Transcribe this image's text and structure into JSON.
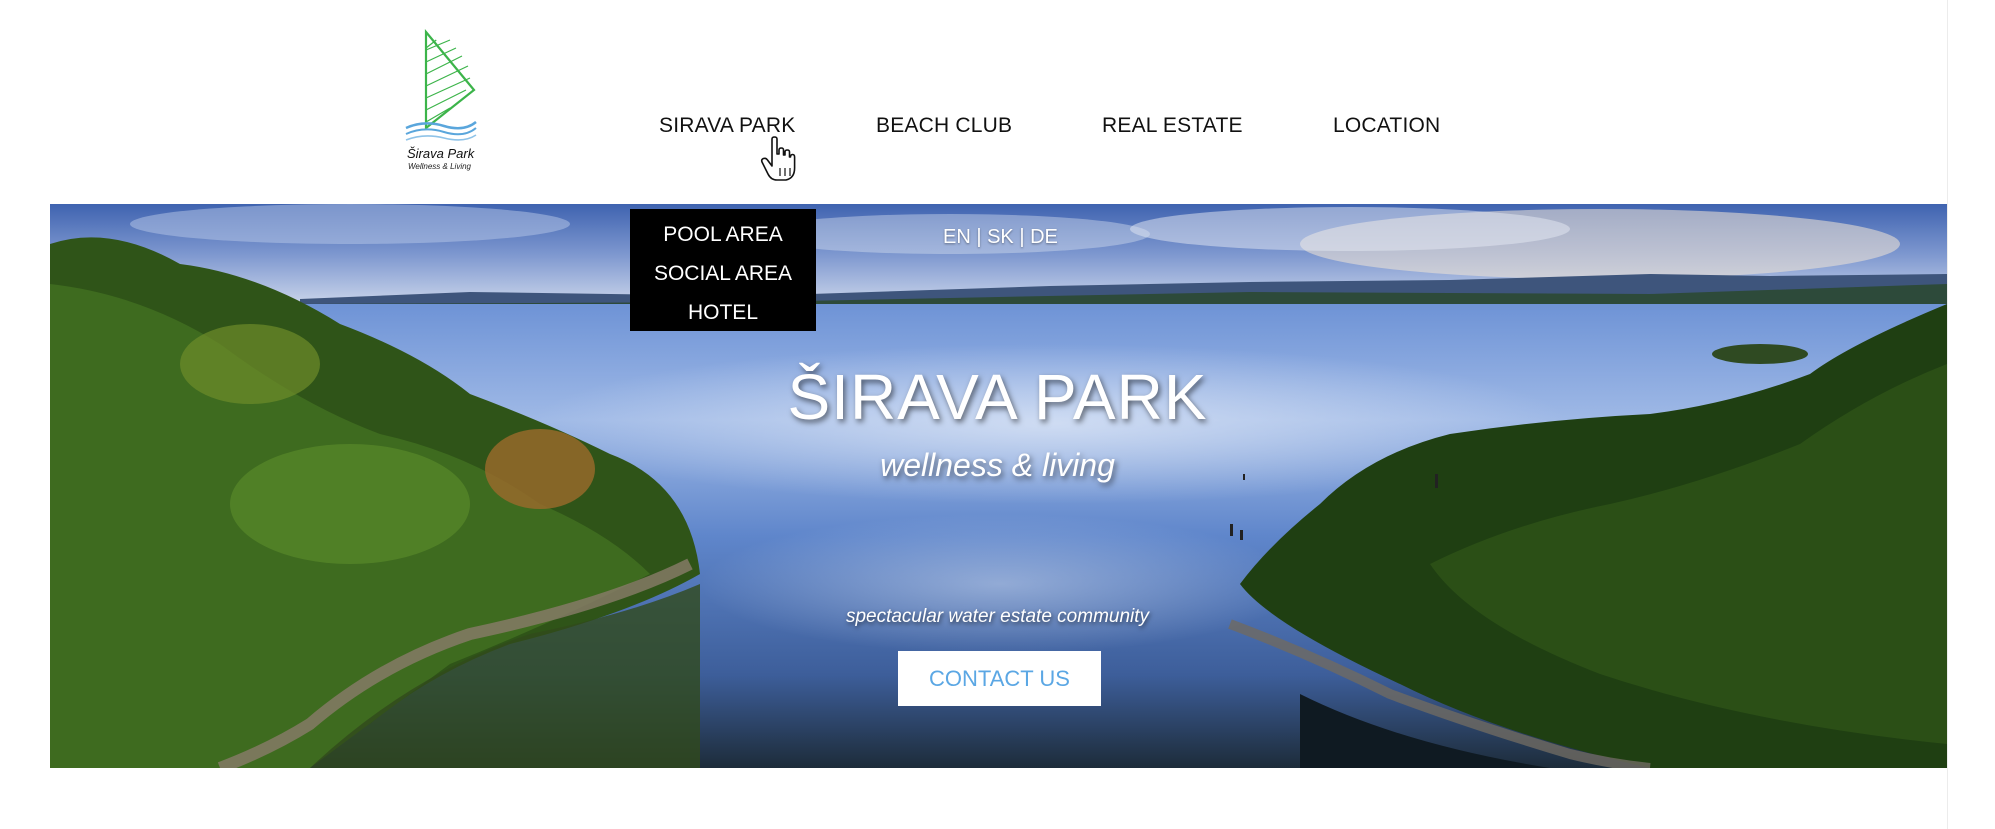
{
  "logo": {
    "name": "Širava Park",
    "tagline": "Wellness & Living",
    "colors": {
      "sail": "#3cb44a",
      "waves": "#5aa6dc"
    }
  },
  "nav": {
    "items": [
      {
        "label": "SIRAVA PARK"
      },
      {
        "label": "BEACH CLUB"
      },
      {
        "label": "REAL ESTATE"
      },
      {
        "label": "LOCATION"
      }
    ]
  },
  "dropdown": {
    "items": [
      {
        "label": "POOL AREA"
      },
      {
        "label": "SOCIAL AREA"
      },
      {
        "label": "HOTEL"
      }
    ]
  },
  "language_switch": "EN | SK | DE",
  "hero": {
    "title": "ŠIRAVA PARK",
    "subtitle": "wellness & living",
    "tagline": "spectacular water estate community",
    "cta_label": "CONTACT US"
  },
  "colors": {
    "nav_text": "#111111",
    "dropdown_bg": "#000000",
    "cta_text": "#5ba7e4"
  },
  "icons": [
    "sail-logo-icon",
    "hand-pointer-cursor-icon"
  ]
}
